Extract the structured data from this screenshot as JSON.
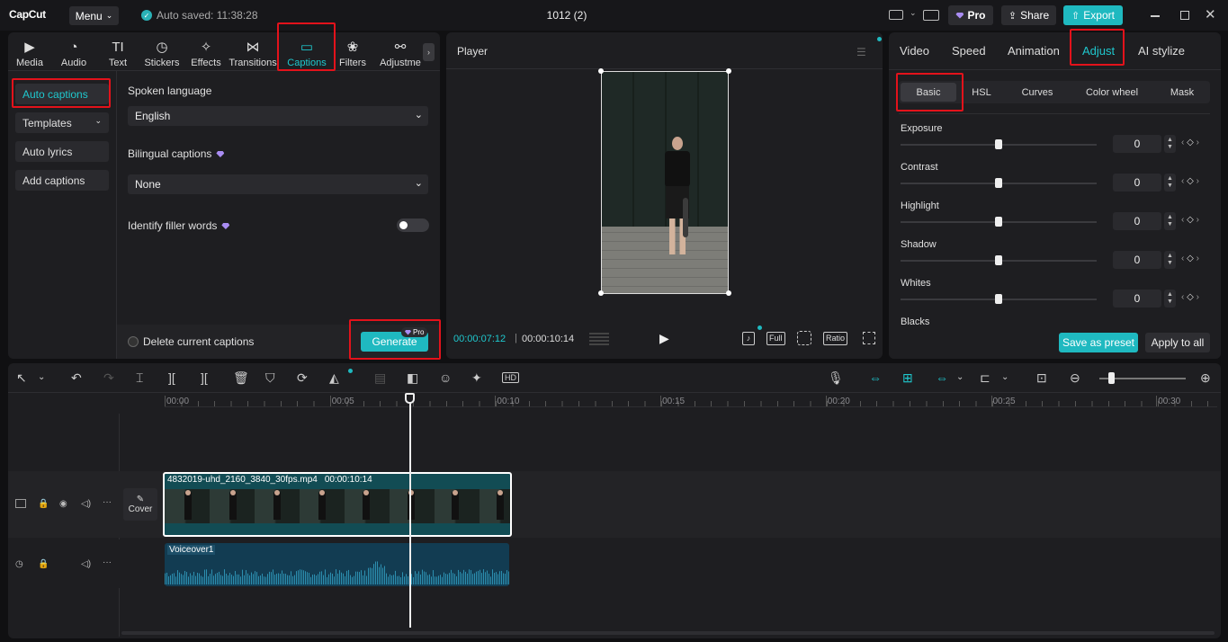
{
  "app": {
    "logo": "CapCut",
    "menu_label": "Menu",
    "autosave": "Auto saved: 11:38:28",
    "project_title": "1012 (2)"
  },
  "topbar": {
    "pro_label": "Pro",
    "share_label": "Share",
    "export_label": "Export"
  },
  "media_tabs": [
    {
      "label": "Media",
      "icon": "▶"
    },
    {
      "label": "Audio",
      "icon": "◔"
    },
    {
      "label": "Text",
      "icon": "TI"
    },
    {
      "label": "Stickers",
      "icon": "◷"
    },
    {
      "label": "Effects",
      "icon": "✧"
    },
    {
      "label": "Transitions",
      "icon": "⋈"
    },
    {
      "label": "Captions",
      "icon": "▭"
    },
    {
      "label": "Filters",
      "icon": "❀"
    },
    {
      "label": "Adjustme",
      "icon": "⚯"
    }
  ],
  "captions_menu": {
    "auto_captions": "Auto captions",
    "templates": "Templates",
    "auto_lyrics": "Auto lyrics",
    "add_captions": "Add captions"
  },
  "captions_settings": {
    "spoken_language_label": "Spoken language",
    "spoken_language_value": "English",
    "bilingual_label": "Bilingual captions",
    "bilingual_value": "None",
    "filler_label": "Identify filler words",
    "delete_current": "Delete current captions",
    "generate": "Generate",
    "generate_badge": "Pro"
  },
  "player": {
    "title": "Player",
    "current_time": "00:00:07:12",
    "total_time": "00:00:10:14",
    "full_label": "Full",
    "ratio_label": "Ratio"
  },
  "inspector": {
    "tabs": [
      "Video",
      "Speed",
      "Animation",
      "Adjust",
      "AI stylize"
    ],
    "subtabs": [
      "Basic",
      "HSL",
      "Curves",
      "Color wheel",
      "Mask"
    ],
    "sliders": [
      {
        "label": "Exposure",
        "value": "0"
      },
      {
        "label": "Contrast",
        "value": "0"
      },
      {
        "label": "Highlight",
        "value": "0"
      },
      {
        "label": "Shadow",
        "value": "0"
      },
      {
        "label": "Whites",
        "value": "0"
      }
    ],
    "blacks_label": "Blacks",
    "save_preset": "Save as preset",
    "apply_all": "Apply to all"
  },
  "timeline": {
    "ticks": [
      "00:00",
      "00:05",
      "00:10",
      "00:15",
      "00:20",
      "00:25",
      "00:30"
    ],
    "clip_name": "4832019-uhd_2160_3840_30fps.mp4",
    "clip_duration": "00:00:10:14",
    "cover_label": "Cover",
    "audio_name": "Voiceover1"
  },
  "colors": {
    "accent": "#1fb9c0",
    "highlight": "#e3121b"
  }
}
